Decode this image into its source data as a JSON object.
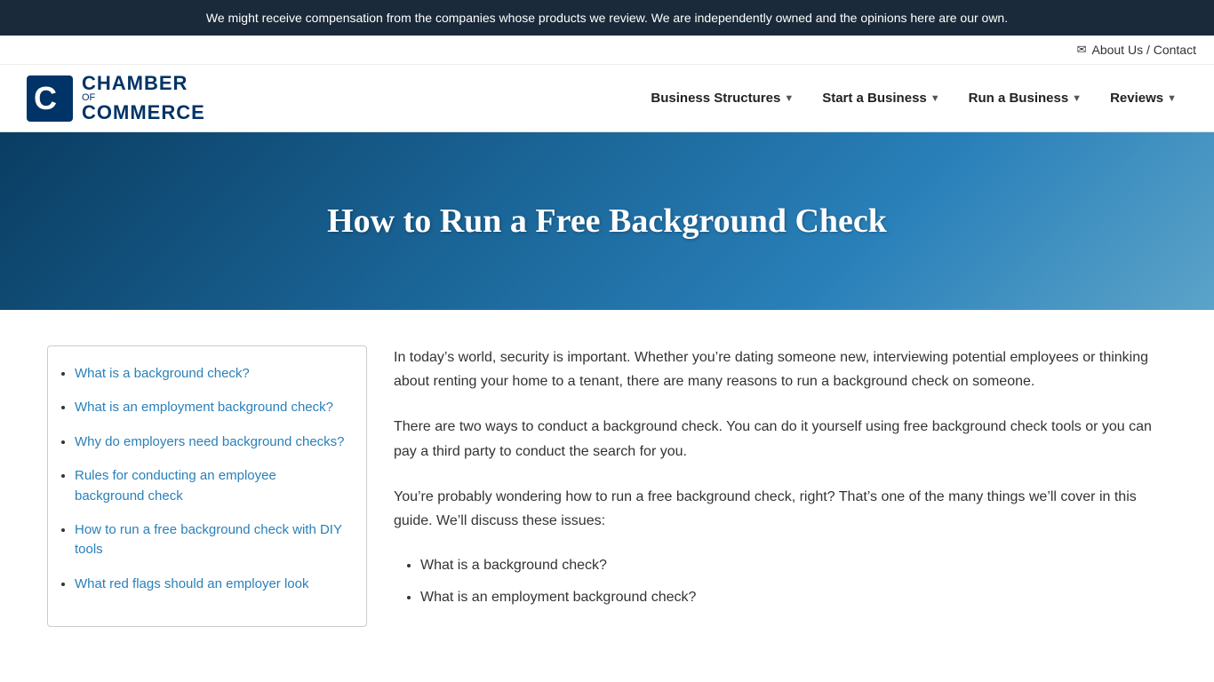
{
  "topBanner": {
    "text": "We might receive compensation from the companies whose products we review. We are independently owned and the opinions here are our own."
  },
  "aboutBar": {
    "linkText": "About Us / Contact"
  },
  "nav": {
    "logo": {
      "chamber": "CHAMBER",
      "of": "OF",
      "commerce": "COMMERCE"
    },
    "items": [
      {
        "label": "Business Structures",
        "hasDropdown": true
      },
      {
        "label": "Start a Business",
        "hasDropdown": true
      },
      {
        "label": "Run a Business",
        "hasDropdown": true
      },
      {
        "label": "Reviews",
        "hasDropdown": true
      }
    ]
  },
  "hero": {
    "title": "How to Run a Free Background Check"
  },
  "toc": {
    "items": [
      {
        "label": "What is a background check?",
        "href": "#what-is-a-background-check"
      },
      {
        "label": "What is an employment background check?",
        "href": "#what-is-an-employment-background-check"
      },
      {
        "label": "Why do employers need background checks?",
        "href": "#why-do-employers-need-background-checks"
      },
      {
        "label": "Rules for conducting an employee background check",
        "href": "#rules-for-conducting-an-employee-background-check"
      },
      {
        "label": "How to run a free background check with DIY tools",
        "href": "#how-to-run-a-free-background-check-with-diy-tools"
      },
      {
        "label": "What red flags should an employer look",
        "href": "#what-red-flags-should-an-employer-look"
      }
    ]
  },
  "article": {
    "paragraphs": [
      "In today’s world, security is important. Whether you’re dating someone new, interviewing potential employees or thinking about renting your home to a tenant, there are many reasons to run a background check on someone.",
      "There are two ways to conduct a background check. You can do it yourself using free background check tools or you can pay a third party to conduct the search for you.",
      "You’re probably wondering how to run a free background check, right? That’s one of the many things we’ll cover in this guide. We’ll discuss these issues:"
    ],
    "listItems": [
      "What is a background check?",
      "What is an employment background check?"
    ]
  }
}
